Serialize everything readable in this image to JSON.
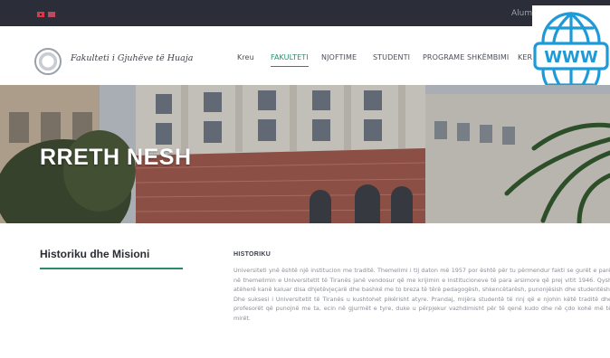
{
  "topbar": {
    "flags": [
      {
        "name": "albanian-flag-icon",
        "color": "#d8384a"
      },
      {
        "name": "english-flag-icon",
        "color": "#b94a62"
      }
    ],
    "alumni_label": "Alumni"
  },
  "header": {
    "logo_text": "Fakulteti i Gjuhëve të Huaja",
    "nav": [
      {
        "label": "Kreu"
      },
      {
        "label": "FAKULTETI",
        "active": true
      },
      {
        "label": "NJOFTIME"
      },
      {
        "label": "STUDENTI"
      },
      {
        "label": "PROGRAME SHKËMBIMI"
      },
      {
        "label": "KER"
      }
    ]
  },
  "overlay": {
    "www_label": "WWW",
    "accent": "#1e9bd7"
  },
  "hero": {
    "title": "RRETH NESH"
  },
  "content": {
    "side_title": "Historiku dhe Misioni",
    "section_title": "HISTORIKU",
    "paragraph": "Universiteti ynë është një institucion me traditë. Themelimi i tij daton më 1957 por është për tu përmendur fakti se gurët e parë në themelimin e Universitetit të Tiranës janë vendosur që me krijimin e institucioneve të para arsimore që prej vitit 1946. Qysh atëherë kanë kaluar disa dhjetëvjeçarë dhe bashkë me to brezа të tërë pedagogësh, shkencëtarësh, punonjësish dhe studentësh. Dhe suksesi i Universitetit të Tiranës u kushtohet pikërisht atyre. Prandaj, mijëra studentë të rinj që e njohin këtë traditë dhe profesorët që punojnë me ta, ecin në gjurmët e tyre, duke u përpjekur vazhdimisht për të qenë kudo dhe në çdo kohë më të mirët.",
    "accent": "#2b8a6e"
  }
}
